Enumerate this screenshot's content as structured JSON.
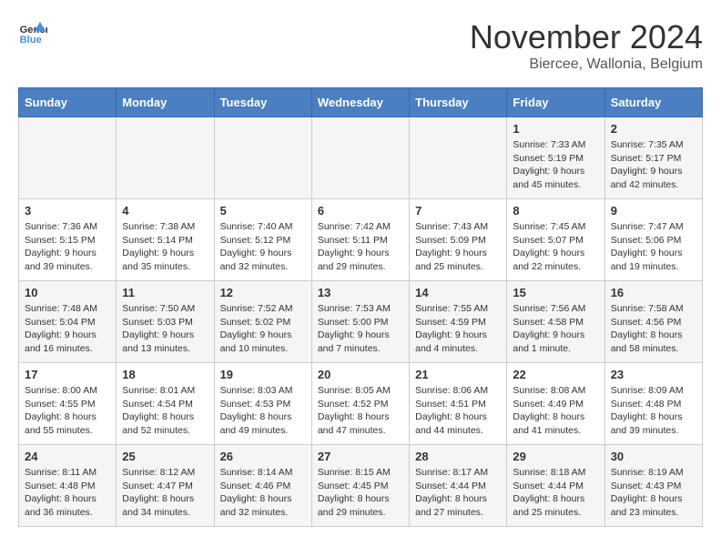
{
  "header": {
    "logo_line1": "General",
    "logo_line2": "Blue",
    "month": "November 2024",
    "location": "Biercee, Wallonia, Belgium"
  },
  "weekdays": [
    "Sunday",
    "Monday",
    "Tuesday",
    "Wednesday",
    "Thursday",
    "Friday",
    "Saturday"
  ],
  "weeks": [
    [
      {
        "day": "",
        "info": ""
      },
      {
        "day": "",
        "info": ""
      },
      {
        "day": "",
        "info": ""
      },
      {
        "day": "",
        "info": ""
      },
      {
        "day": "",
        "info": ""
      },
      {
        "day": "1",
        "info": "Sunrise: 7:33 AM\nSunset: 5:19 PM\nDaylight: 9 hours and 45 minutes."
      },
      {
        "day": "2",
        "info": "Sunrise: 7:35 AM\nSunset: 5:17 PM\nDaylight: 9 hours and 42 minutes."
      }
    ],
    [
      {
        "day": "3",
        "info": "Sunrise: 7:36 AM\nSunset: 5:15 PM\nDaylight: 9 hours and 39 minutes."
      },
      {
        "day": "4",
        "info": "Sunrise: 7:38 AM\nSunset: 5:14 PM\nDaylight: 9 hours and 35 minutes."
      },
      {
        "day": "5",
        "info": "Sunrise: 7:40 AM\nSunset: 5:12 PM\nDaylight: 9 hours and 32 minutes."
      },
      {
        "day": "6",
        "info": "Sunrise: 7:42 AM\nSunset: 5:11 PM\nDaylight: 9 hours and 29 minutes."
      },
      {
        "day": "7",
        "info": "Sunrise: 7:43 AM\nSunset: 5:09 PM\nDaylight: 9 hours and 25 minutes."
      },
      {
        "day": "8",
        "info": "Sunrise: 7:45 AM\nSunset: 5:07 PM\nDaylight: 9 hours and 22 minutes."
      },
      {
        "day": "9",
        "info": "Sunrise: 7:47 AM\nSunset: 5:06 PM\nDaylight: 9 hours and 19 minutes."
      }
    ],
    [
      {
        "day": "10",
        "info": "Sunrise: 7:48 AM\nSunset: 5:04 PM\nDaylight: 9 hours and 16 minutes."
      },
      {
        "day": "11",
        "info": "Sunrise: 7:50 AM\nSunset: 5:03 PM\nDaylight: 9 hours and 13 minutes."
      },
      {
        "day": "12",
        "info": "Sunrise: 7:52 AM\nSunset: 5:02 PM\nDaylight: 9 hours and 10 minutes."
      },
      {
        "day": "13",
        "info": "Sunrise: 7:53 AM\nSunset: 5:00 PM\nDaylight: 9 hours and 7 minutes."
      },
      {
        "day": "14",
        "info": "Sunrise: 7:55 AM\nSunset: 4:59 PM\nDaylight: 9 hours and 4 minutes."
      },
      {
        "day": "15",
        "info": "Sunrise: 7:56 AM\nSunset: 4:58 PM\nDaylight: 9 hours and 1 minute."
      },
      {
        "day": "16",
        "info": "Sunrise: 7:58 AM\nSunset: 4:56 PM\nDaylight: 8 hours and 58 minutes."
      }
    ],
    [
      {
        "day": "17",
        "info": "Sunrise: 8:00 AM\nSunset: 4:55 PM\nDaylight: 8 hours and 55 minutes."
      },
      {
        "day": "18",
        "info": "Sunrise: 8:01 AM\nSunset: 4:54 PM\nDaylight: 8 hours and 52 minutes."
      },
      {
        "day": "19",
        "info": "Sunrise: 8:03 AM\nSunset: 4:53 PM\nDaylight: 8 hours and 49 minutes."
      },
      {
        "day": "20",
        "info": "Sunrise: 8:05 AM\nSunset: 4:52 PM\nDaylight: 8 hours and 47 minutes."
      },
      {
        "day": "21",
        "info": "Sunrise: 8:06 AM\nSunset: 4:51 PM\nDaylight: 8 hours and 44 minutes."
      },
      {
        "day": "22",
        "info": "Sunrise: 8:08 AM\nSunset: 4:49 PM\nDaylight: 8 hours and 41 minutes."
      },
      {
        "day": "23",
        "info": "Sunrise: 8:09 AM\nSunset: 4:48 PM\nDaylight: 8 hours and 39 minutes."
      }
    ],
    [
      {
        "day": "24",
        "info": "Sunrise: 8:11 AM\nSunset: 4:48 PM\nDaylight: 8 hours and 36 minutes."
      },
      {
        "day": "25",
        "info": "Sunrise: 8:12 AM\nSunset: 4:47 PM\nDaylight: 8 hours and 34 minutes."
      },
      {
        "day": "26",
        "info": "Sunrise: 8:14 AM\nSunset: 4:46 PM\nDaylight: 8 hours and 32 minutes."
      },
      {
        "day": "27",
        "info": "Sunrise: 8:15 AM\nSunset: 4:45 PM\nDaylight: 8 hours and 29 minutes."
      },
      {
        "day": "28",
        "info": "Sunrise: 8:17 AM\nSunset: 4:44 PM\nDaylight: 8 hours and 27 minutes."
      },
      {
        "day": "29",
        "info": "Sunrise: 8:18 AM\nSunset: 4:44 PM\nDaylight: 8 hours and 25 minutes."
      },
      {
        "day": "30",
        "info": "Sunrise: 8:19 AM\nSunset: 4:43 PM\nDaylight: 8 hours and 23 minutes."
      }
    ]
  ]
}
